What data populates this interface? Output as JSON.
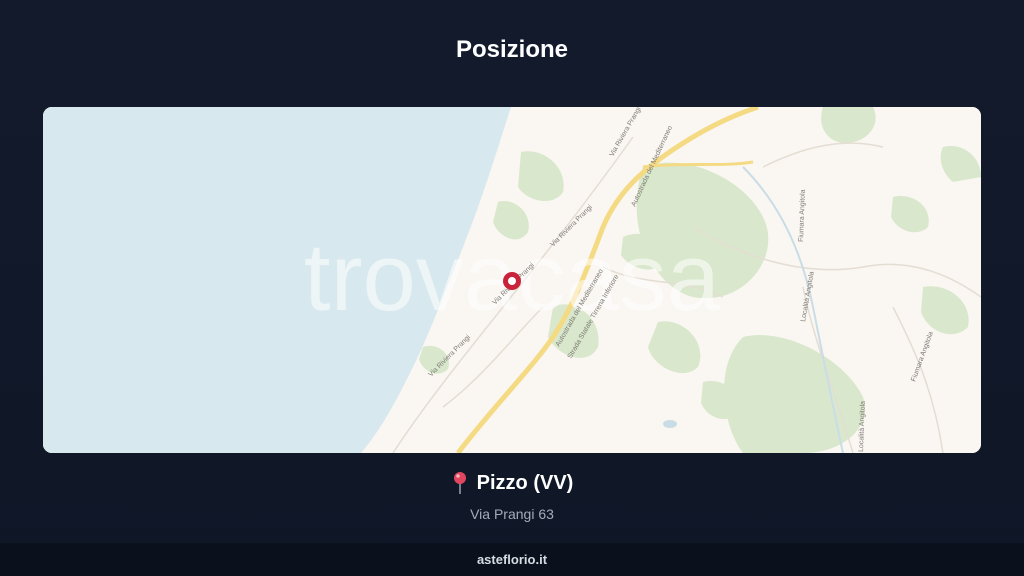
{
  "page": {
    "title": "Posizione"
  },
  "map": {
    "watermark": "trovacasa",
    "road_labels": [
      "Via Riviera Prangi",
      "Via Riviera Prangi",
      "Via Riviera Prangi",
      "Via Riviera Prangi",
      "Autostrada del Mediterraneo",
      "Autostrada del Mediterraneo",
      "Strada Statale Tirrena Inferiore",
      "Fiumara Angitola",
      "Località Angitola",
      "Località Angitola",
      "Fiumara Angitola"
    ],
    "colors": {
      "sea": "#d7e8ee",
      "land": "#faf6f1",
      "green": "#d9e8cc",
      "highway": "#f5da84",
      "marker": "#c8233a"
    }
  },
  "location": {
    "city": "Pizzo (VV)",
    "address": "Via Prangi 63"
  },
  "footer": {
    "brand": "asteflorio.it"
  }
}
